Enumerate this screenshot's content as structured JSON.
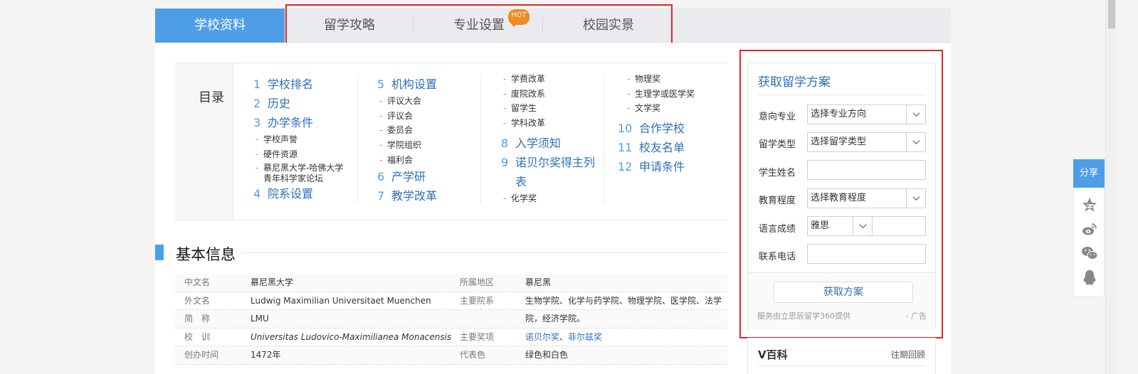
{
  "tabs": [
    {
      "label": "学校资料",
      "active": true
    },
    {
      "label": "留学攻略"
    },
    {
      "label": "专业设置",
      "badge": "HOT"
    },
    {
      "label": "校园实景"
    }
  ],
  "toc": {
    "label": "目录",
    "col1": {
      "i1": {
        "n": "1",
        "t": "学校排名"
      },
      "i2": {
        "n": "2",
        "t": "历史"
      },
      "i3": {
        "n": "3",
        "t": "办学条件"
      },
      "i3s": [
        "学校声誉",
        "硬件资源",
        "慕尼黑大学-哈佛大学青年科学家论坛"
      ],
      "i4": {
        "n": "4",
        "t": "院系设置"
      }
    },
    "col2": {
      "i5": {
        "n": "5",
        "t": "机构设置"
      },
      "i5s": [
        "评议大会",
        "评议会",
        "委员会",
        "学院组织",
        "福利会"
      ],
      "i6": {
        "n": "6",
        "t": "产学研"
      },
      "i7": {
        "n": "7",
        "t": "教学改革"
      }
    },
    "col3": {
      "i7s": [
        "学费改革",
        "废院改系",
        "留学生",
        "学科改革"
      ],
      "i8": {
        "n": "8",
        "t": "入学须知"
      },
      "i9": {
        "n": "9",
        "t": "诺贝尔奖得主列表"
      },
      "i9s": [
        "化学奖"
      ]
    },
    "col4": {
      "i9s2": [
        "物理奖",
        "生理学或医学奖",
        "文学奖"
      ],
      "i10": {
        "n": "10",
        "t": "合作学校"
      },
      "i11": {
        "n": "11",
        "t": "校友名单"
      },
      "i12": {
        "n": "12",
        "t": "申请条件"
      }
    }
  },
  "section": {
    "title": "基本信息"
  },
  "info": {
    "r1": {
      "k1": "中文名",
      "v1": "慕尼黑大学",
      "k2": "所属地区",
      "v2": "慕尼黑"
    },
    "r2": {
      "k1": "外文名",
      "v1": "Ludwig Maximilian Universitaet Muenchen",
      "k2": "主要院系",
      "v2": "生物学院、化学与药学院、物理学院、医学院、法学"
    },
    "r3": {
      "k1": "简　称",
      "v1": "LMU",
      "v2": "院，经济学院。"
    },
    "r4": {
      "k1": "校　训",
      "v1": "Universitas Ludovico-Maximilianea Monacensis",
      "k2": "主要奖项",
      "v2a": "诺贝尔奖",
      "sep": "、",
      "v2b": "菲尔兹奖"
    },
    "r5": {
      "k1": "创办时间",
      "v1": "1472年",
      "k2": "代表色",
      "v2": "绿色和白色"
    }
  },
  "form": {
    "title": "获取留学方案",
    "major_label": "意向专业",
    "major_value": "选择专业方向",
    "type_label": "留学类型",
    "type_value": "选择留学类型",
    "name_label": "学生姓名",
    "edu_label": "教育程度",
    "edu_value": "选择教育程度",
    "lang_label": "语言成绩",
    "lang_value": "雅思",
    "phone_label": "联系电话",
    "submit": "获取方案",
    "provider": "服务由立思辰留学360提供",
    "ad": "- 广告"
  },
  "vbaike": {
    "title": "V百科",
    "link": "往期回顾"
  },
  "share": {
    "label": "分享"
  }
}
